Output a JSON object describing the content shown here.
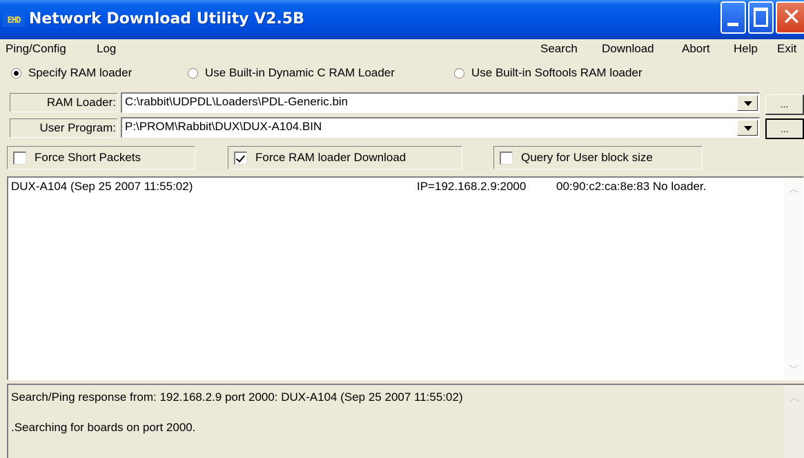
{
  "window": {
    "icon_text": "EHD",
    "title": "Network Download Utility V2.5B"
  },
  "menu": {
    "left": [
      "Ping/Config",
      "Log"
    ],
    "right": [
      "Search",
      "Download",
      "Abort",
      "Help",
      "Exit"
    ]
  },
  "loader_options": [
    {
      "label": "Specify RAM loader",
      "selected": true
    },
    {
      "label": "Use Built-in Dynamic C RAM Loader",
      "selected": false
    },
    {
      "label": "Use Built-in Softools  RAM loader",
      "selected": false
    }
  ],
  "ram_loader": {
    "label": "RAM Loader:",
    "value": "C:\\rabbit\\UDPDL\\Loaders\\PDL-Generic.bin",
    "browse_label": "..."
  },
  "user_program": {
    "label": "User Program:",
    "value": "P:\\PROM\\Rabbit\\DUX\\DUX-A104.BIN",
    "browse_label": "..."
  },
  "checkboxes": [
    {
      "label": "Force Short Packets",
      "checked": false
    },
    {
      "label": "Force RAM loader Download",
      "checked": true
    },
    {
      "label": "Query for User block size",
      "checked": false
    }
  ],
  "boards": [
    {
      "name": "DUX-A104 (Sep 25 2007 11:55:02)",
      "ip": "IP=192.168.2.9:2000",
      "mac": "00:90:c2:ca:8e:83 No loader."
    }
  ],
  "log": [
    "Search/Ping response from: 192.168.2.9 port 2000: DUX-A104 (Sep 25 2007 11:55:02)",
    ".Searching for boards on port 2000."
  ],
  "colors": {
    "titlebar": "#0055e5",
    "close_button": "#d2401e",
    "window_face": "#ece9d8"
  }
}
